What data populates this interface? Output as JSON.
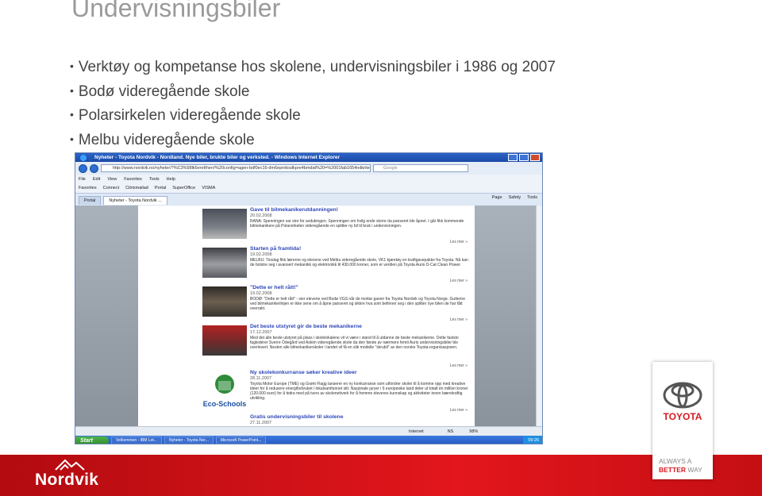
{
  "slide": {
    "title": "Undervisningsbiler",
    "bullets": [
      "Verktøy og kompetanse hos skolene, undervisningsbiler i 1986 og 2007",
      "Bodø videregående skole",
      "Polarsirkelen videregående skole",
      "Melbu videregående skole"
    ]
  },
  "browser": {
    "title": "Nyheter - Toyota Nordvik - Nordland. Nye biler, brukte biler og verksted. - Windows Internet Explorer",
    "address": "http://www.nordvik.no/nyheter/?%C3%98lk6ereItherr/%20config=agen-bdf0ec16-dm6eprebsdkpre4bmdat%20=%2001fab1654ndkriteridee16",
    "search_placeholder": "Google",
    "menu": [
      "File",
      "Edit",
      "View",
      "Favorites",
      "Tools",
      "Help"
    ],
    "links": [
      "Favorites",
      "Connect",
      "Citrixmailad",
      "Portal",
      "SuperOffice",
      "VISMA"
    ],
    "tabs": [
      "Portal",
      "Nyheter - Toyota Nordvik ..."
    ],
    "commands": [
      "Page",
      "Safety",
      "Tools"
    ],
    "articles": [
      {
        "title": "Gave til bilmekanikerutdanningen!",
        "date": "20.02.2008",
        "body": "RANA: Spenningen var stor for avdukingen. Spenningen om hvilg ende storre da panseret ble åpnet. I går fikk kommende bilmekanikere på Polarsirkelen videregående en splitter ny bil til bruk i undervisningen.",
        "more": "Les mer »"
      },
      {
        "title": "Starten på framtida!",
        "date": "19.02.2008",
        "body": "MELBU: Tirsdag fikk lærerne og elevene ved Melbu videregående skole, VK1 kjøretøy en kraftgavepakke fra Toyota. Nå kan de bolstre seg i avansert mekanikk og elektronikk til 430.000 kroner, som er verdien på Toyota Auris D-Cat Clean Power.",
        "more": "Les mer »"
      },
      {
        "title": "\"Dette er helt rått!\"",
        "date": "19.02.2008",
        "body": "BODØ: \"Dette er helt rått\" - sier elevene ved Bodø VGS når de mottar gaven fra Toyota Nordvik og Toyota Norge. Gutterne ved bilmekanikerlinjen er ikke sene om å åpne panseret og sikkre hva som befinner seg i den splitter nye bilen de har fått overrakt.",
        "more": "Les mer »"
      },
      {
        "title": "Det beste utstyret gir de beste mekanikerne",
        "date": "17.12.2007",
        "body": "Med det alle beste utstyret på plass i skolelokalene vil vi være i stand til å utdanne de beste mekanikerne. Dette fastslo faglederer Sverre Ödegård ved Askim videregående skole da den første av nærmere femti Auris undervisningsbiler ble overlevert. Nesten alle bilmekanikerskoler i landet vil få en slik modelle \"skrubil\" av den norske Toyota-organisasjonen.",
        "more": "Les mer »"
      },
      {
        "title": "Ny skolekonkurranse søker kreative ideer",
        "date": "28.11.2007",
        "body": "Toyota Motor Europe (TME) og Grønt Flagg lanserer en ny konkurranse som utfordrer skoler til å komme opp med kreative ideer for å redusere energiforbruket i lokalsamfunnet sitt. Nasjonale juryer i 6 europeiske land deler ut totalt én million kroner (120.000 euro) for å bidra med på tvers av skolenettverk for å fremme eleveres kunnskap og aktiviteter innen bærekraftig utvikling.",
        "more": "Les mer »"
      },
      {
        "title": "Gratis undervisningsbiler til skolene",
        "date": "27.11.2007",
        "body": "",
        "more": ""
      }
    ],
    "status": {
      "zone": "Internet",
      "ns": "NS",
      "zoom": "98%",
      "time": "09:26"
    },
    "taskbar": {
      "start": "Start",
      "tasks": [
        "Velkommen - IBM Lot...",
        "Nyheter - Toyota Nor...",
        "Microsoft PowerPoint..."
      ]
    }
  },
  "branding": {
    "nordvik": "Nordvik",
    "toyota": "TOYOTA",
    "slogan_line1": "ALWAYS A",
    "slogan_line2_a": "BETTER",
    "slogan_line2_b": "WAY"
  },
  "colors": {
    "footer_red": "#d7151b",
    "link_blue": "#2d46b9",
    "toyota_red": "#d71920"
  }
}
